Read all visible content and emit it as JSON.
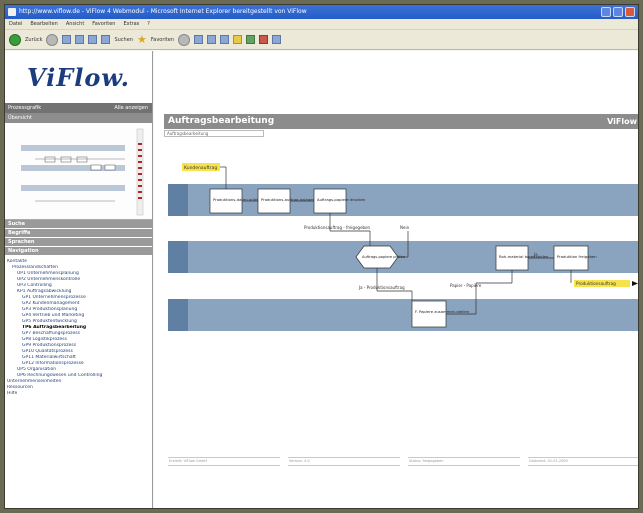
{
  "window": {
    "title": "http://www.viflow.de - ViFlow 4 Webmodul - Microsoft Internet Explorer bereitgestellt von ViFlow"
  },
  "menu": [
    "Datei",
    "Bearbeiten",
    "Ansicht",
    "Favoriten",
    "Extras",
    "?"
  ],
  "toolbar": {
    "back_label": "Zurück",
    "search_label": "Suchen",
    "favorites_label": "Favoriten"
  },
  "sidebar": {
    "logo": "ViFlow.",
    "strip_left": "Prozessgrafik",
    "strip_right": "Alle anzeigen",
    "overview_label": "Übersicht",
    "menu_items": [
      "Suche",
      "Begriffe",
      "Sprachen",
      "Navigation"
    ],
    "tree": [
      {
        "text": "Kontakte",
        "indent": 0,
        "bold": false
      },
      {
        "text": "Prozesslandschaften",
        "indent": 1,
        "bold": false
      },
      {
        "text": "UP1 Unternehmensplanung",
        "indent": 2,
        "bold": false
      },
      {
        "text": "UP2 Unternehmenskontrolle",
        "indent": 2,
        "bold": false
      },
      {
        "text": "UP3 Controlling",
        "indent": 2,
        "bold": false
      },
      {
        "text": "KP1 Auftragsabwicklung",
        "indent": 2,
        "bold": false
      },
      {
        "text": "GP1 Unternehmensprozesse",
        "indent": 3,
        "bold": false
      },
      {
        "text": "GP2 Kundenmanagement",
        "indent": 3,
        "bold": false
      },
      {
        "text": "GP3 Produktionsplanung",
        "indent": 3,
        "bold": false
      },
      {
        "text": "GP4 Vertrieb und Marketing",
        "indent": 3,
        "bold": false
      },
      {
        "text": "GP5 Produktentwicklung",
        "indent": 3,
        "bold": false
      },
      {
        "text": "TP6 Auftragsbearbeitung",
        "indent": 3,
        "bold": true
      },
      {
        "text": "GP7 Beschaffungsprozess",
        "indent": 3,
        "bold": false
      },
      {
        "text": "GP8 Logistikprozess",
        "indent": 3,
        "bold": false
      },
      {
        "text": "GP9 Produktionsprozess",
        "indent": 3,
        "bold": false
      },
      {
        "text": "GP10 Qualitätsprozess",
        "indent": 3,
        "bold": false
      },
      {
        "text": "GP11 Materialwirtschaft",
        "indent": 3,
        "bold": false
      },
      {
        "text": "GP12 Informationsprozesse",
        "indent": 3,
        "bold": false
      },
      {
        "text": "UP5 Organisation",
        "indent": 2,
        "bold": false
      },
      {
        "text": "UP6 Rechnungswesen und Controlling",
        "indent": 2,
        "bold": false
      },
      {
        "text": "Unternehmenseinheiten",
        "indent": 0,
        "bold": false
      },
      {
        "text": "Ressourcen",
        "indent": 0,
        "bold": false
      },
      {
        "text": "Hilfe",
        "indent": 0,
        "bold": false
      }
    ]
  },
  "page": {
    "title": "Auftragsbearbeitung",
    "brand": "ViFlow",
    "subtitle": "Auftragsbearbeitung"
  },
  "diagram": {
    "start_label": "Kundenauftrag",
    "end_label": "Produktionsauftrag",
    "processes": [
      {
        "id": "p1",
        "label": "Produktions-daten prüfen"
      },
      {
        "id": "p2",
        "label": "Produktions-auftrag anlegen"
      },
      {
        "id": "p3",
        "label": "Auftrags-papiere drucken"
      },
      {
        "id": "p4",
        "label": "Auftrags-papiere prüfen"
      },
      {
        "id": "p5",
        "label": "Roh-material bereitstellen"
      },
      {
        "id": "p6",
        "label": "Produktion freigeben"
      },
      {
        "id": "p7",
        "label": "F. Papiere zusammen-stellen"
      }
    ],
    "flows": [
      {
        "label": "Produktionsauftrag - freigegeben"
      },
      {
        "label": "Nein"
      },
      {
        "label": "Ja - Produktionsauftrag"
      },
      {
        "label": "Ja"
      },
      {
        "label": "Papier - Papiere"
      }
    ]
  },
  "footer": [
    "Erstellt: ViFlow GmbH",
    "Version: 4.0",
    "Status: freigegeben",
    "Geändert: 01.01.2009"
  ],
  "colors": {
    "lane": "#8aa3bf",
    "lane_tab": "#5f7fa3",
    "highlight": "#f6e24a",
    "header": "#8c8c8c"
  }
}
